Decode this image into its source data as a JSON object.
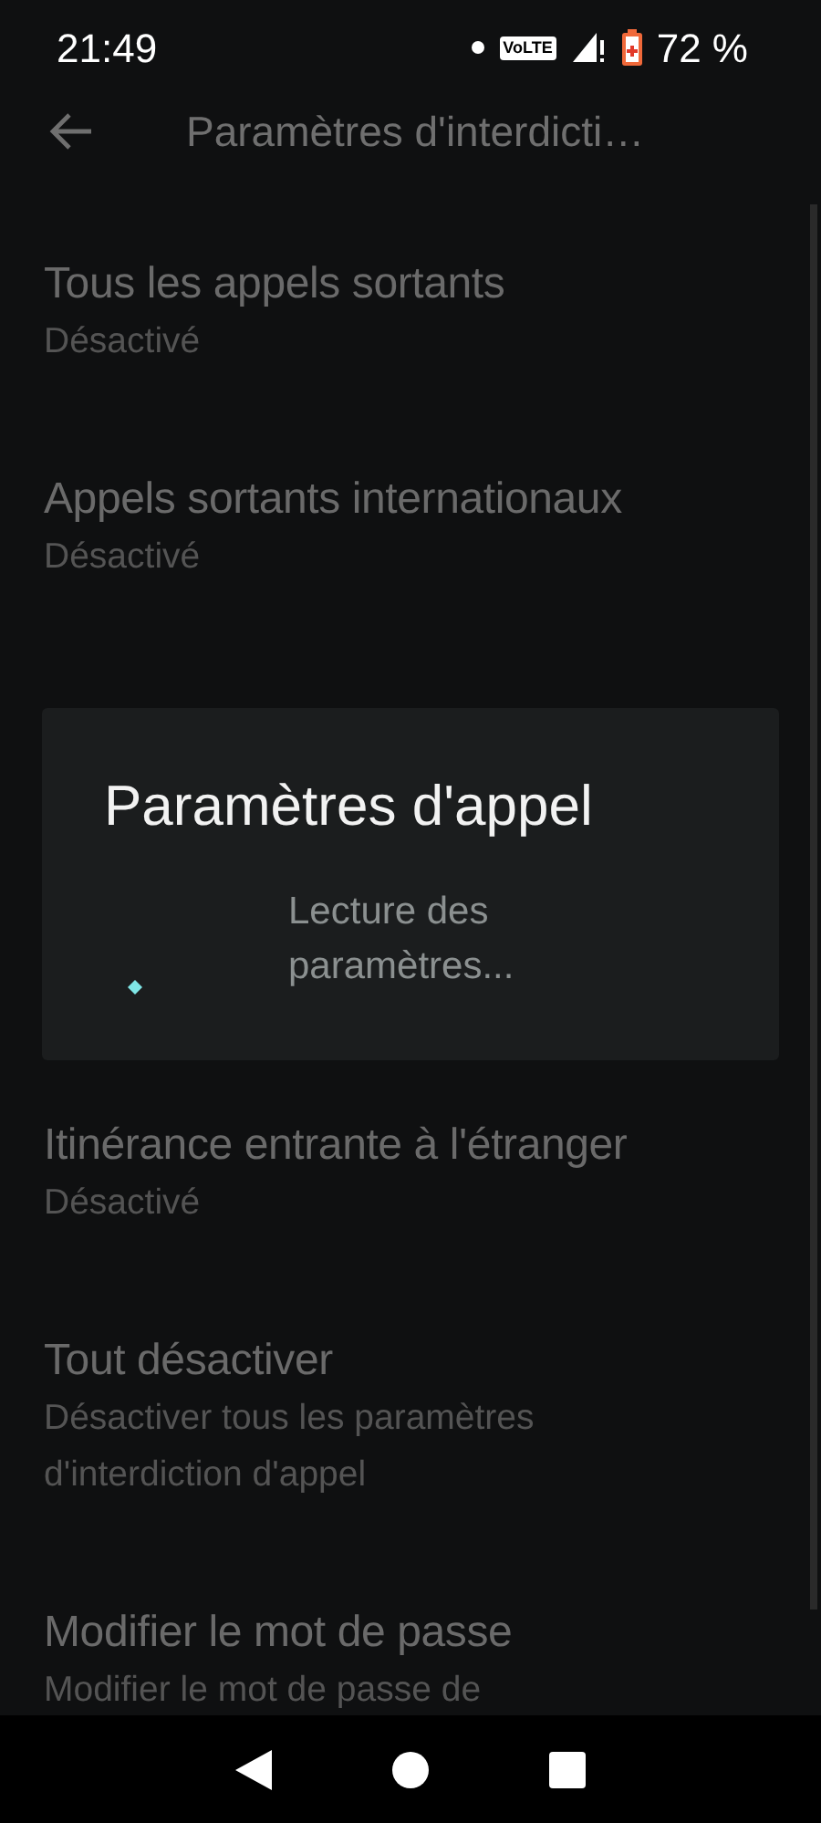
{
  "status_bar": {
    "time": "21:49",
    "network_badge": "VoLTE",
    "battery": "72 %"
  },
  "toolbar": {
    "title": "Paramètres d'interdicti…"
  },
  "items_above_dialog": [
    {
      "title": "Tous les appels sortants",
      "summary": "Désactivé"
    },
    {
      "title": "Appels sortants internationaux",
      "summary": "Désactivé"
    }
  ],
  "dialog": {
    "title": "Paramètres d'appel",
    "message": "Lecture des paramètres..."
  },
  "items_below_dialog": [
    {
      "title": "Itinérance entrante à l'étranger",
      "summary": "Désactivé"
    },
    {
      "title": "Tout désactiver",
      "summary": "Désactiver tous les paramètres d'interdiction d'appel"
    },
    {
      "title": "Modifier le mot de passe",
      "summary": "Modifier le mot de passe de"
    }
  ]
}
